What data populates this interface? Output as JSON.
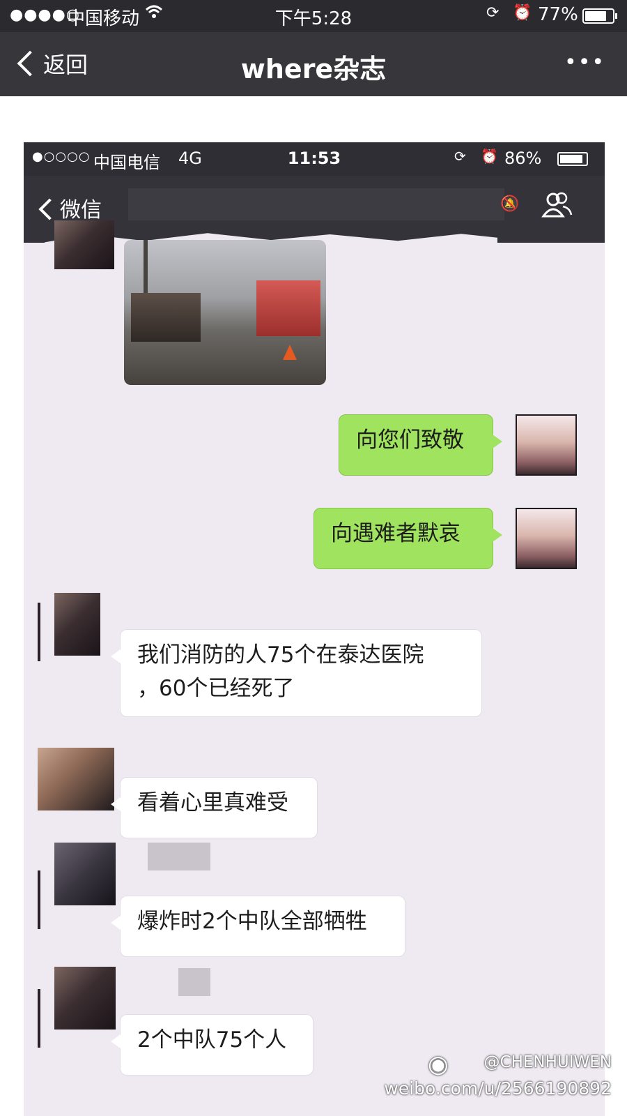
{
  "outer_status": {
    "signal": "●●●●○",
    "carrier": "中国移动",
    "time": "下午5:28",
    "battery_pct": "77%",
    "battery_level": 0.77
  },
  "outer_nav": {
    "back_label": "返回",
    "title": "where杂志",
    "more_label": "•••"
  },
  "inner_status": {
    "signal": "●○○○○",
    "carrier": "中国电信",
    "network": "4G",
    "time": "11:53",
    "battery_pct": "86%",
    "battery_level": 0.86
  },
  "inner_nav": {
    "back_label": "微信"
  },
  "messages": [
    {
      "text": "向您们致敬"
    },
    {
      "text": "向遇难者默哀"
    },
    {
      "text": "我们消防的人75个在泰达医院"
    },
    {
      "text": "，60个已经死了"
    },
    {
      "text": "看着心里真难受"
    },
    {
      "text": "爆炸时2个中队全部牺牲"
    },
    {
      "text": "2个中队75个人"
    }
  ],
  "watermark": {
    "handle": "@CHENHUIWEN",
    "url": "weibo.com/u/2566190892"
  },
  "icons": [
    "wifi-icon",
    "lock-rotation-icon",
    "alarm-icon",
    "battery-icon",
    "back-chevron-icon",
    "more-icon",
    "mute-icon",
    "group-icon",
    "weibo-icon"
  ]
}
